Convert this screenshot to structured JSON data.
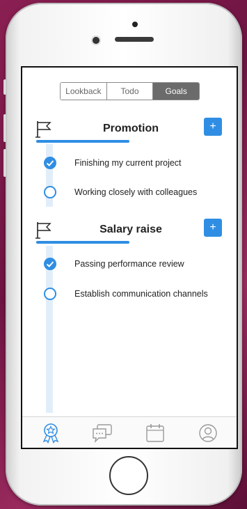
{
  "segments": [
    "Lookback",
    "Todo",
    "Goals"
  ],
  "active_segment": "Goals",
  "goals": [
    {
      "title": "Promotion",
      "add_label": "+",
      "tasks": [
        {
          "label": "Finishing my current project",
          "done": true
        },
        {
          "label": "Working closely with colleagues",
          "done": false
        }
      ]
    },
    {
      "title": "Salary raise",
      "add_label": "+",
      "tasks": [
        {
          "label": "Passing performance review",
          "done": true
        },
        {
          "label": "Establish communication channels",
          "done": false
        }
      ]
    }
  ],
  "tabbar": [
    "award-icon",
    "chat-icon",
    "calendar-icon",
    "profile-icon"
  ],
  "colors": {
    "accent": "#2f8ee3",
    "rail": "#e1eefa",
    "segment_active": "#6b6b6b"
  }
}
